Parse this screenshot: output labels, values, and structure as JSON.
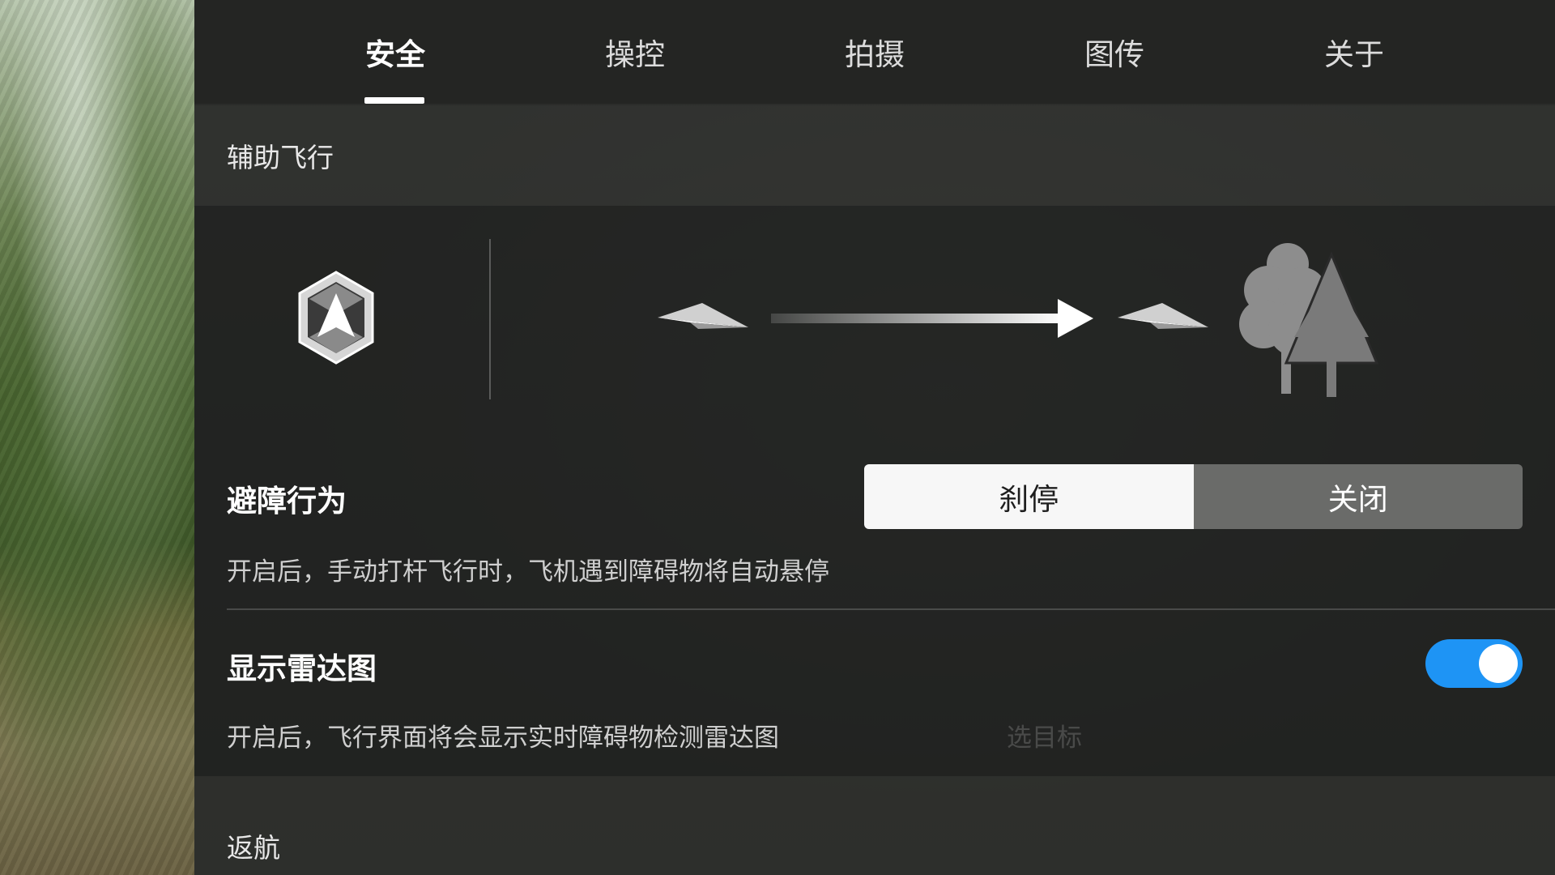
{
  "tabs": [
    {
      "label": "安全",
      "active": true
    },
    {
      "label": "操控",
      "active": false
    },
    {
      "label": "拍摄",
      "active": false
    },
    {
      "label": "图传",
      "active": false
    },
    {
      "label": "关于",
      "active": false
    }
  ],
  "assisted_flight": {
    "section_title": "辅助飞行",
    "icons": [
      "drone-nav-icon",
      "paper-plane-icon",
      "arrow-right-icon",
      "paper-plane-icon",
      "trees-icon"
    ]
  },
  "obstacle_avoidance": {
    "title": "避障行为",
    "options": [
      "刹停",
      "关闭"
    ],
    "selected": "刹停",
    "description": "开启后，手动打杆飞行时，飞机遇到障碍物将自动悬停"
  },
  "radar_map": {
    "title": "显示雷达图",
    "enabled": true,
    "description": "开启后，飞行界面将会显示实时障碍物检测雷达图",
    "toggle_color": "#1e94f5"
  },
  "background_overlay_text": "选目标",
  "return_home": {
    "section_title": "返航"
  }
}
